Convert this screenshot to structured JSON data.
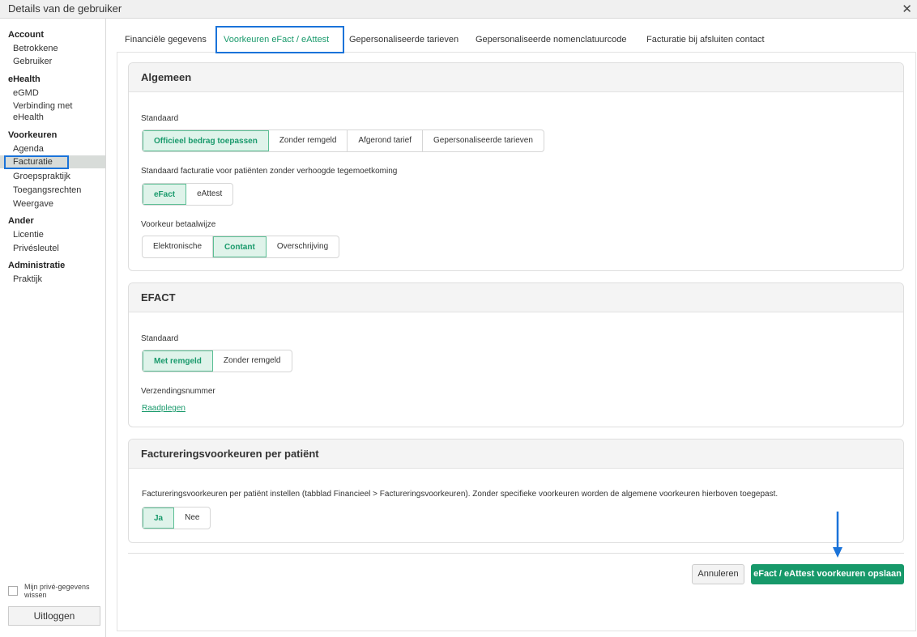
{
  "window": {
    "title": "Details van de gebruiker",
    "close_symbol": "✕"
  },
  "sidebar": {
    "sections": [
      {
        "title": "Account",
        "items": [
          "Betrokkene",
          "Gebruiker"
        ]
      },
      {
        "title": "eHealth",
        "items": [
          "eGMD",
          "Verbinding met eHealth"
        ]
      },
      {
        "title": "Voorkeuren",
        "items": [
          "Agenda",
          "Facturatie",
          "Groepspraktijk",
          "Toegangsrechten",
          "Weergave"
        ]
      },
      {
        "title": "Ander",
        "items": [
          "Licentie",
          "Privésleutel"
        ]
      },
      {
        "title": "Administratie",
        "items": [
          "Praktijk"
        ]
      }
    ],
    "verbinding_line1": "Verbinding met",
    "verbinding_line2": "eHealth",
    "active_item": "Facturatie",
    "privacy_label": "Mijn privé-gegevens wissen",
    "logout_label": "Uitloggen"
  },
  "tabs": [
    "Financiële gegevens",
    "Voorkeuren eFact / eAttest",
    "Gepersonaliseerde tarieven",
    "Gepersonaliseerde nomenclatuurcode",
    "Facturatie bij afsluiten contact"
  ],
  "active_tab": "Voorkeuren eFact / eAttest",
  "algemeen": {
    "title": "Algemeen",
    "standaard_label": "Standaard",
    "standaard_options": [
      "Officieel bedrag toepassen",
      "Zonder remgeld",
      "Afgerond tarief",
      "Gepersonaliseerde tarieven"
    ],
    "standaard_selected": "Officieel bedrag toepassen",
    "facturatie_label": "Standaard facturatie voor patiënten zonder verhoogde tegemoetkoming",
    "facturatie_options": [
      "eFact",
      "eAttest"
    ],
    "facturatie_selected": "eFact",
    "betaalwijze_label": "Voorkeur betaalwijze",
    "betaalwijze_options": [
      "Elektronische",
      "Contant",
      "Overschrijving"
    ],
    "betaalwijze_selected": "Contant"
  },
  "efact": {
    "title": "EFACT",
    "standaard_label": "Standaard",
    "standaard_options": [
      "Met remgeld",
      "Zonder remgeld"
    ],
    "standaard_selected": "Met remgeld",
    "verzending_label": "Verzendingsnummer",
    "verzending_link": "Raadplegen"
  },
  "per_patient": {
    "title": "Factureringsvoorkeuren per patiënt",
    "description": "Factureringsvoorkeuren per patiënt instellen (tabblad Financieel > Factureringsvoorkeuren). Zonder specifieke voorkeuren worden de algemene voorkeuren hierboven toegepast.",
    "options": [
      "Ja",
      "Nee"
    ],
    "selected": "Ja"
  },
  "footer": {
    "cancel_label": "Annuleren",
    "save_label": "eFact / eAttest voorkeuren opslaan"
  },
  "colors": {
    "accent": "#17996a",
    "highlight": "#1a73d9",
    "selected_bg": "#dff3ea"
  }
}
